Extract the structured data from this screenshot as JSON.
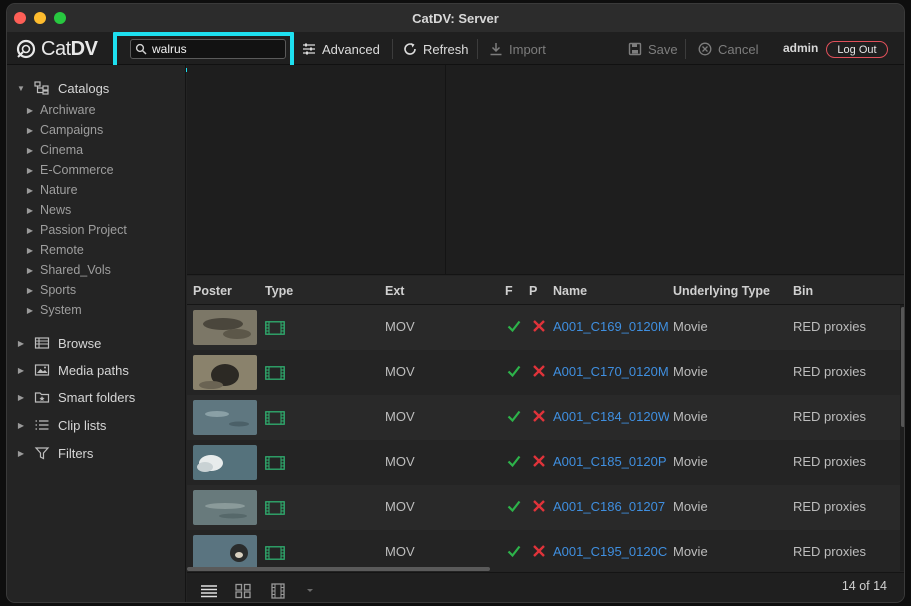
{
  "window": {
    "title": "CatDV: Server"
  },
  "toolbar": {
    "logo_cat": "Cat",
    "logo_dv": "DV",
    "search_value": "walrus",
    "advanced": "Advanced",
    "refresh": "Refresh",
    "import": "Import",
    "save": "Save",
    "cancel": "Cancel",
    "user": "admin",
    "logout": "Log Out"
  },
  "sidebar": {
    "catalogs_label": "Catalogs",
    "catalogs": [
      "Archiware",
      "Campaigns",
      "Cinema",
      "E-Commerce",
      "Nature",
      "News",
      "Passion Project",
      "Remote",
      "Shared_Vols",
      "Sports",
      "System"
    ],
    "sections": [
      "Browse",
      "Media paths",
      "Smart folders",
      "Clip lists",
      "Filters"
    ]
  },
  "table": {
    "columns": [
      "Poster",
      "Type",
      "Ext",
      "F",
      "P",
      "Name",
      "Underlying Type",
      "Bin"
    ],
    "rows": [
      {
        "ext": "MOV",
        "name": "A001_C169_0120M",
        "underlying": "Movie",
        "bin": "RED proxies",
        "f": true,
        "p": false
      },
      {
        "ext": "MOV",
        "name": "A001_C170_0120M",
        "underlying": "Movie",
        "bin": "RED proxies",
        "f": true,
        "p": false
      },
      {
        "ext": "MOV",
        "name": "A001_C184_0120W",
        "underlying": "Movie",
        "bin": "RED proxies",
        "f": true,
        "p": false
      },
      {
        "ext": "MOV",
        "name": "A001_C185_0120P",
        "underlying": "Movie",
        "bin": "RED proxies",
        "f": true,
        "p": false
      },
      {
        "ext": "MOV",
        "name": "A001_C186_01207",
        "underlying": "Movie",
        "bin": "RED proxies",
        "f": true,
        "p": false
      },
      {
        "ext": "MOV",
        "name": "A001_C195_0120C",
        "underlying": "Movie",
        "bin": "RED proxies",
        "f": true,
        "p": false
      }
    ]
  },
  "footer": {
    "count": "14 of 14"
  },
  "colors": {
    "accent_link": "#3f8fe0",
    "check": "#2db34a",
    "cross": "#e0333a",
    "highlight": "#1ee0f0"
  }
}
